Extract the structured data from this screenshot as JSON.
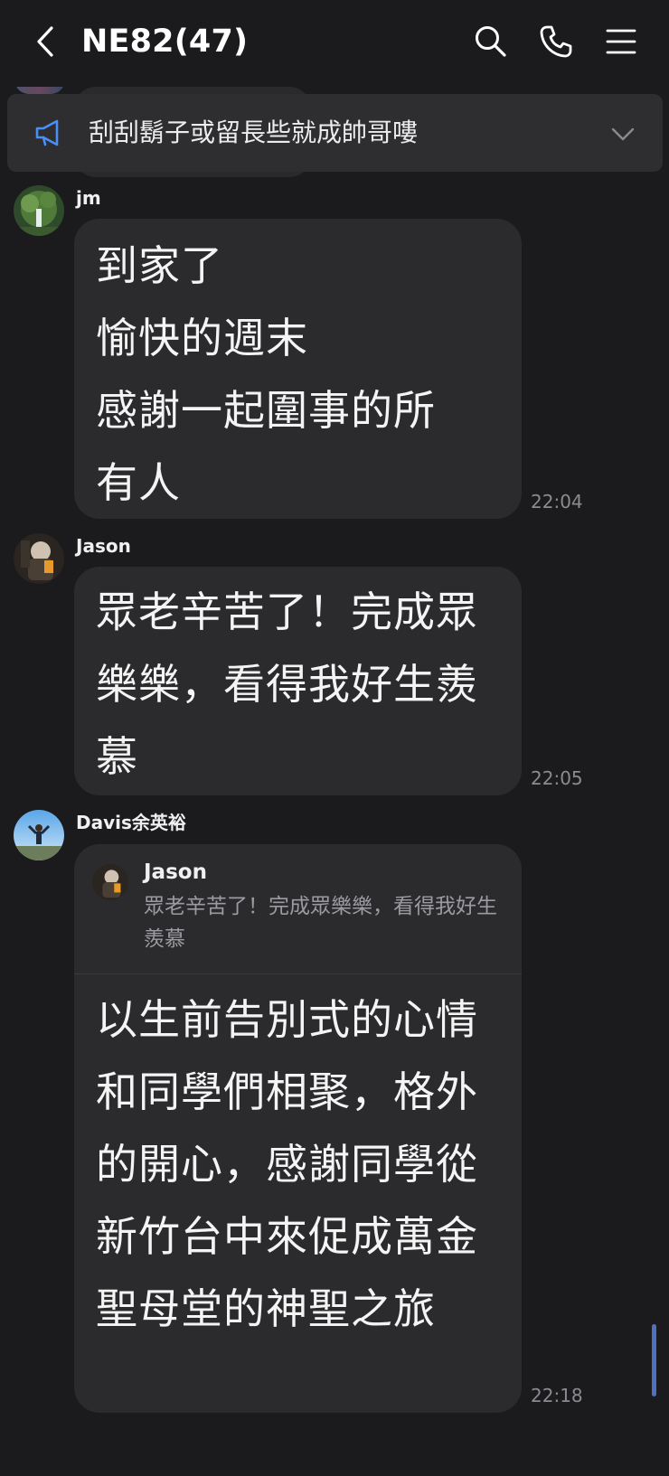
{
  "header": {
    "title": "NE82(47)",
    "icons": [
      "back-icon",
      "search-icon",
      "phone-icon",
      "menu-icon"
    ]
  },
  "announcement": {
    "text": "刮刮鬍子或留長些就成帥哥嘍",
    "icon": "megaphone-icon",
    "accent": "#4a8ef7"
  },
  "messages": [
    {
      "sender": "jm",
      "text": "到家了\n愉快的週末\n感謝一起圍事的所有人",
      "time": "22:04"
    },
    {
      "sender": "Jason",
      "text": "眾老辛苦了！完成眾樂樂，看得我好生羨慕",
      "time": "22:05"
    },
    {
      "sender": "Davis余英裕",
      "reply_to": {
        "sender": "Jason",
        "text": "眾老辛苦了！完成眾樂樂，看得我好生羨慕"
      },
      "text": "以生前告別式的心情和同學們相聚，格外的開心，感謝同學從新竹台中來促成萬金聖母堂的神聖之旅",
      "time": "22:18"
    }
  ],
  "colors": {
    "background": "#1b1b1d",
    "bubble": "#2b2b2e",
    "announcement_bg": "#2e2e31",
    "timestamp": "#8b8b90",
    "scroll_thumb": "#4f6fc0"
  }
}
